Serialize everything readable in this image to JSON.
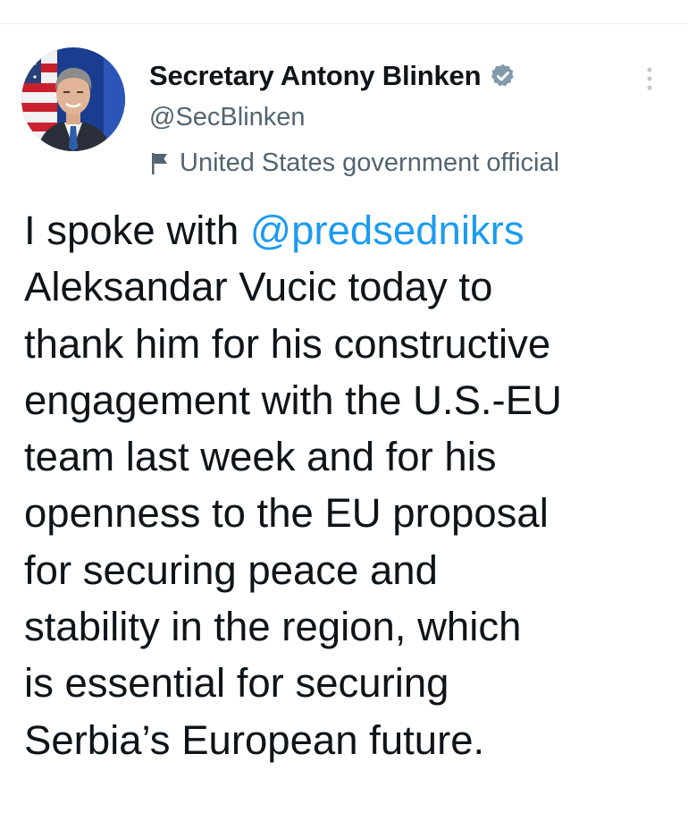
{
  "tweet": {
    "author": {
      "display_name": "Secretary Antony Blinken",
      "handle": "@SecBlinken",
      "verified_icon": "verified-badge-icon",
      "label_icon": "flag-icon",
      "label": "United States government official",
      "avatar": "author-avatar-photo"
    },
    "more_icon": "more-vertical-icon",
    "text": {
      "line1_prefix": "I spoke with ",
      "mention": "@predsednikrs",
      "line2": "Aleksandar Vucic today to",
      "line3": "thank him for his constructive",
      "line4": "engagement with the U.S.-EU",
      "line5": "team last week and for his",
      "line6": "openness to the EU proposal",
      "line7": "for securing peace and",
      "line8": "stability in the region, which",
      "line9": "is essential for securing",
      "line10": "Serbia’s European future."
    }
  },
  "colors": {
    "text": "#0f1419",
    "secondary": "#536471",
    "link": "#1d9bf0",
    "verified": "#829aab"
  }
}
